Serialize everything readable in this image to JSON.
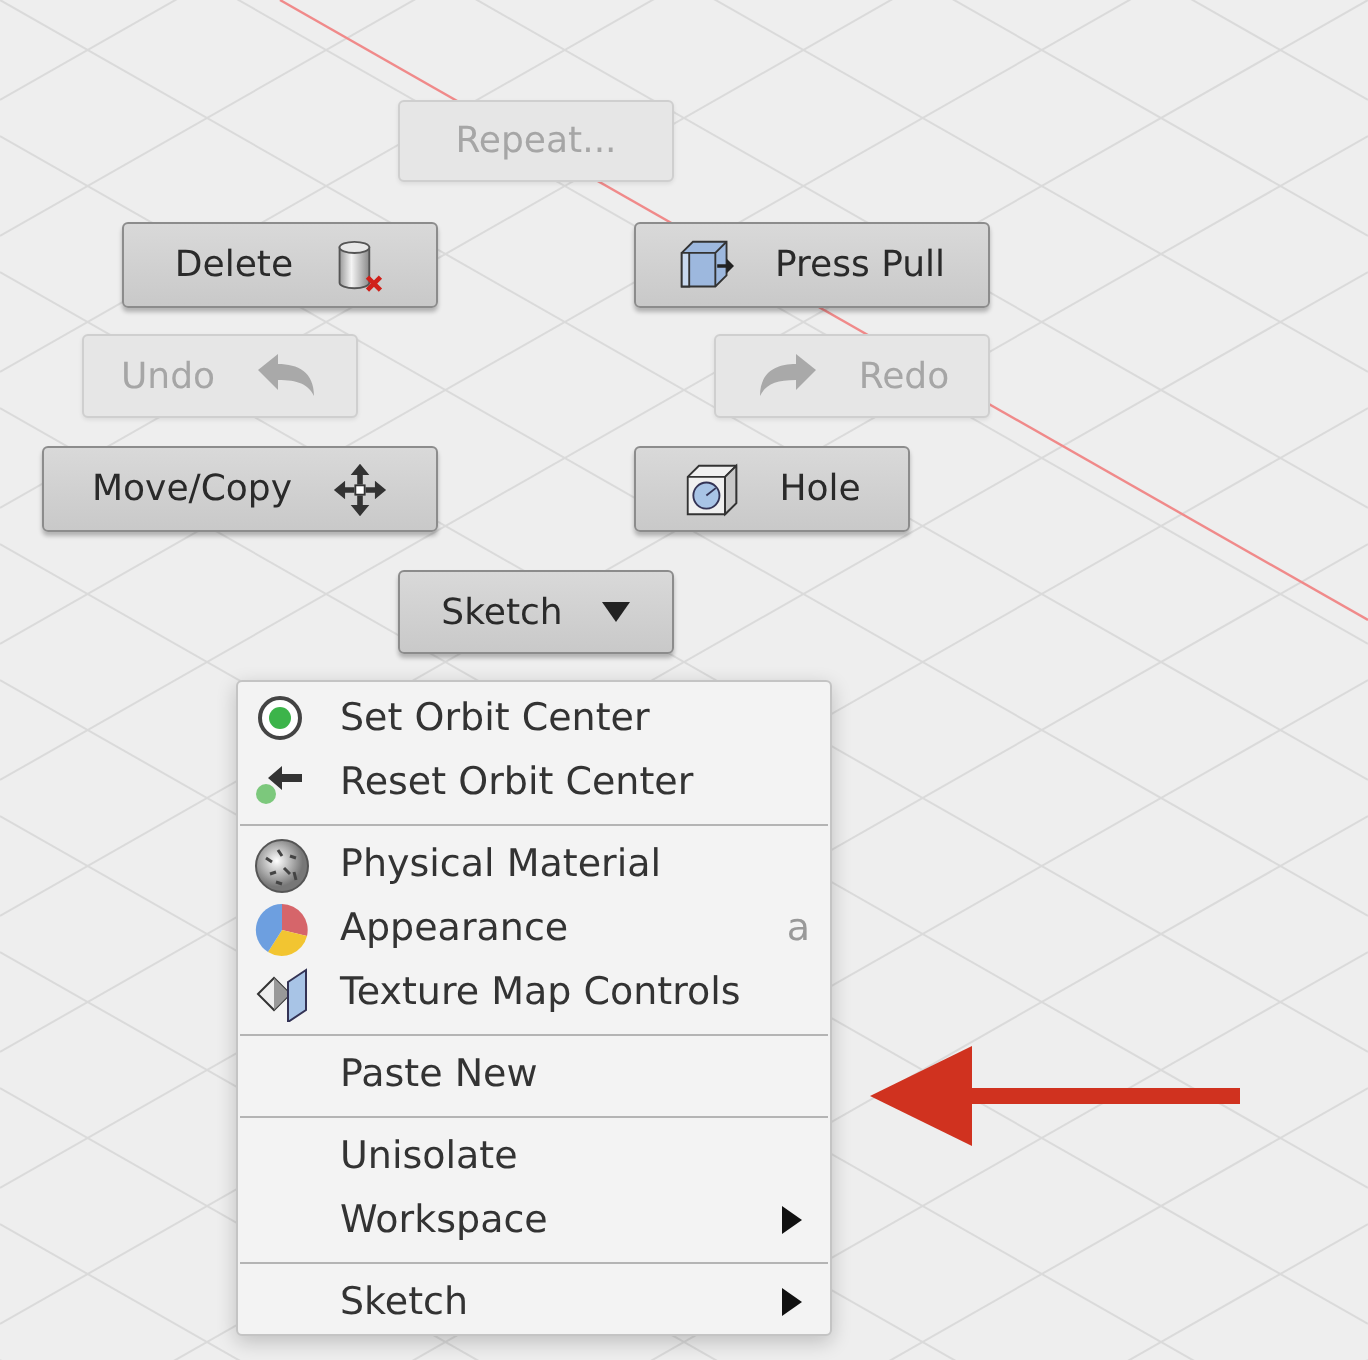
{
  "buttons": [
    {
      "label": "Repeat...",
      "disabled": true,
      "dropdown": false
    },
    {
      "label": "Delete",
      "disabled": false,
      "dropdown": false
    },
    {
      "label": "Press Pull",
      "disabled": false,
      "dropdown": false
    },
    {
      "label": "Undo",
      "disabled": true,
      "dropdown": false
    },
    {
      "label": "Redo",
      "disabled": true,
      "dropdown": false
    },
    {
      "label": "Move/Copy",
      "disabled": false,
      "dropdown": false
    },
    {
      "label": "Hole",
      "disabled": false,
      "dropdown": false
    },
    {
      "label": "Sketch",
      "disabled": false,
      "dropdown": true
    }
  ],
  "context_menu": {
    "sections": [
      {
        "items": [
          {
            "label": "Set Orbit Center",
            "submenu": false
          },
          {
            "label": "Reset Orbit Center",
            "submenu": false
          }
        ]
      },
      {
        "items": [
          {
            "label": "Physical Material",
            "submenu": false
          },
          {
            "label": "Appearance",
            "shortcut": "a",
            "submenu": false
          },
          {
            "label": "Texture Map Controls",
            "submenu": false
          }
        ]
      },
      {
        "items": [
          {
            "label": "Paste New",
            "submenu": false
          }
        ]
      },
      {
        "items": [
          {
            "label": "Unisolate",
            "submenu": false
          },
          {
            "label": "Workspace",
            "submenu": true
          }
        ]
      },
      {
        "items": [
          {
            "label": "Sketch",
            "submenu": true
          }
        ]
      }
    ]
  }
}
